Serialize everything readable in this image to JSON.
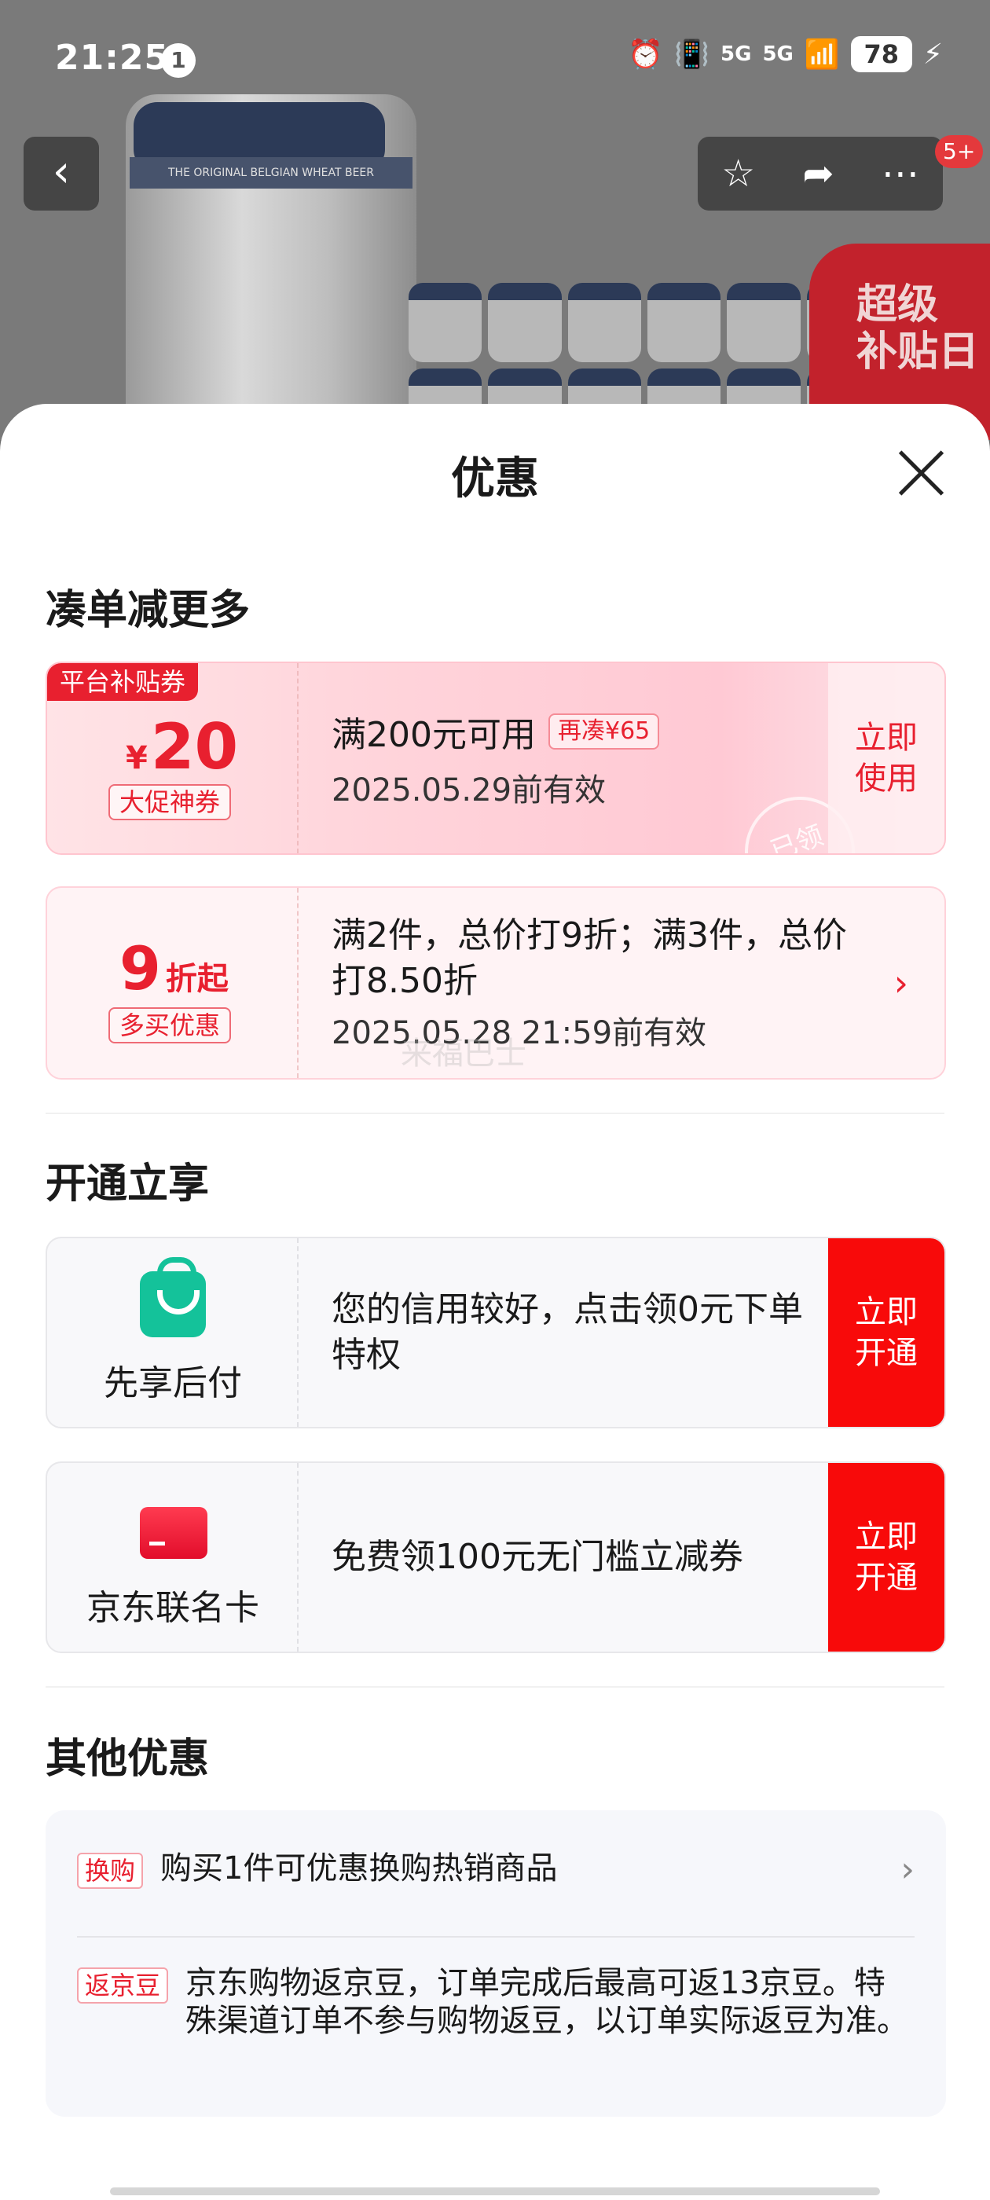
{
  "status_bar": {
    "time": "21:25",
    "notification_count": "1",
    "signal_1": "5G",
    "signal_2": "5G",
    "battery": "78"
  },
  "header": {
    "cart_badge": "5+",
    "promo_badge": "超级\n补贴日",
    "can_text": "THE ORIGINAL BELGIAN WHEAT BEER"
  },
  "sheet": {
    "title": "优惠",
    "section_1": "凑单减更多",
    "coupon": {
      "tag": "平台补贴券",
      "currency": "¥",
      "amount": "20",
      "type": "大促神券",
      "condition": "满200元可用",
      "gap_chip": "再凑¥65",
      "validity": "2025.05.29前有效",
      "button": "立即\n使用",
      "stamp": "已领"
    },
    "discount": {
      "number": "9",
      "suffix": "折起",
      "type": "多买优惠",
      "rule": "满2件，总价打9折；满3件，总价打8.50折",
      "validity": "2025.05.28 21:59前有效",
      "watermark": "来福巴士"
    },
    "section_2": "开通立享",
    "services": [
      {
        "name": "先享后付",
        "icon": "shopping-bag-icon",
        "text": "您的信用较好，点击领0元下单特权",
        "button": "立即\n开通"
      },
      {
        "name": "京东联名卡",
        "icon": "credit-card-icon",
        "text": "免费领100元无门槛立减券",
        "button": "立即\n开通"
      }
    ],
    "section_3": "其他优惠",
    "others": [
      {
        "tag": "换购",
        "text": "购买1件可优惠换购热销商品"
      },
      {
        "tag": "返京豆",
        "text": "京东购物返京豆，订单完成后最高可返13京豆。特殊渠道订单不参与购物返豆，以订单实际返豆为准。"
      }
    ]
  },
  "colors": {
    "accent": "#e8202f",
    "open_button": "#f80a0a",
    "green": "#14c29a"
  }
}
